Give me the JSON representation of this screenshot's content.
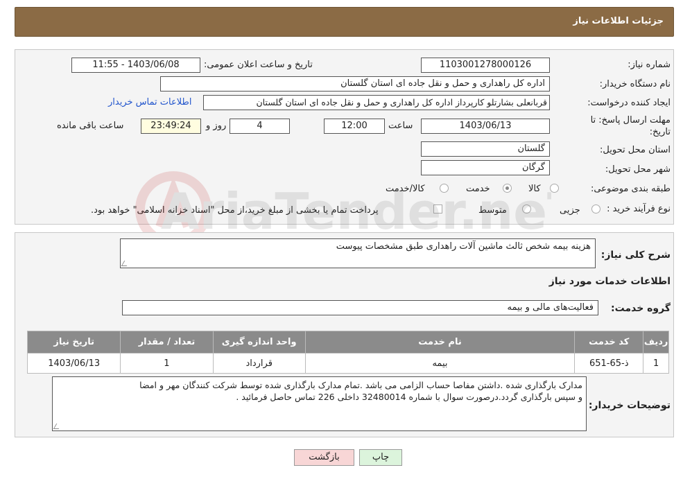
{
  "header": {
    "title": "جزئیات اطلاعات نیاز"
  },
  "form": {
    "need_number": {
      "label": "شماره نیاز:",
      "value": "1103001278000126"
    },
    "announce": {
      "label": "تاریخ و ساعت اعلان عمومی:",
      "value": "1403/06/08 - 11:55"
    },
    "buyer_org": {
      "label": "نام دستگاه خریدار:",
      "value": "اداره کل راهداری و حمل و نقل جاده ای استان گلستان"
    },
    "requester": {
      "label": "ایجاد کننده درخواست:",
      "value": "قربانعلی بشارتلو کارپرداز اداره کل راهداری و حمل و نقل جاده ای استان گلستان",
      "contact_link": "اطلاعات تماس خریدار"
    },
    "deadline": {
      "label_line1": "مهلت ارسال پاسخ: تا",
      "label_line2": "تاریخ:",
      "date": "1403/06/13",
      "time_label": "ساعت",
      "time": "12:00",
      "days": "4",
      "days_label": "روز و",
      "remaining": "23:49:24",
      "remaining_label": "ساعت باقی مانده"
    },
    "province": {
      "label": "استان محل تحویل:",
      "value": "گلستان"
    },
    "city": {
      "label": "شهر محل تحویل:",
      "value": "گرگان"
    },
    "category": {
      "label": "طبقه بندی موضوعی:",
      "options": [
        "کالا",
        "خدمت",
        "کالا/خدمت"
      ],
      "selected": "خدمت"
    },
    "process": {
      "label": "نوع فرآیند خرید :",
      "options": [
        "جزیی",
        "متوسط"
      ],
      "note": "پرداخت تمام یا بخشی از مبلغ خرید،از محل \"اسناد خزانه اسلامی\" خواهد بود."
    }
  },
  "summary": {
    "label": "شرح کلی نیاز:",
    "value": "هزینه بیمه شخص ثالث ماشین آلات راهداری طبق مشخصات پیوست"
  },
  "services": {
    "title": "اطلاعات خدمات مورد نیاز",
    "group_label": "گروه خدمت:",
    "group_value": "فعالیت‌های مالی و بیمه",
    "columns": [
      "ردیف",
      "کد خدمت",
      "نام خدمت",
      "واحد اندازه گیری",
      "تعداد / مقدار",
      "تاریخ نیاز"
    ],
    "rows": [
      {
        "row": "1",
        "code": "ذ-65-651",
        "name": "بیمه",
        "unit": "قرارداد",
        "qty": "1",
        "date": "1403/06/13"
      }
    ]
  },
  "buyer_notes": {
    "label": "توضیحات خریدار:",
    "line1": "مدارک بارگذاری شده .داشتن مفاصا حساب الزامی می باشد .تمام مدارک بارگذاری شده توسط شرکت کنندگان مهر و امضا",
    "line2": "و سپس بارگذاری گردد.درصورت سوال با شماره 32480014 داخلی 226 تماس حاصل فرمائید ."
  },
  "buttons": {
    "print": "چاپ",
    "back": "بازگشت"
  },
  "watermark_text": "AriaTender.neT"
}
